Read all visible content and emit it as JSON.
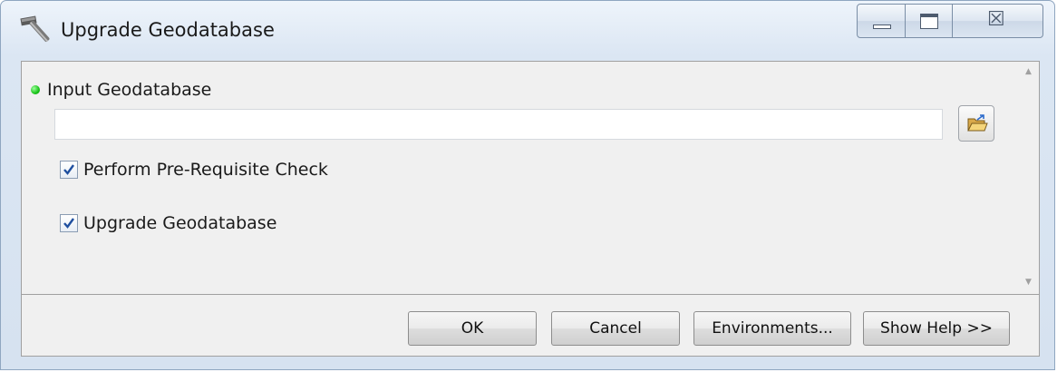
{
  "window": {
    "title": "Upgrade Geodatabase",
    "title_icon": "hammer-icon",
    "caption_buttons": {
      "minimize_icon": "minimize-icon",
      "maximize_icon": "maximize-icon",
      "close_icon": "close-icon",
      "close_glyph": "☒"
    }
  },
  "parameters": {
    "input_geodatabase": {
      "label": "Input Geodatabase",
      "required_indicator": "green-dot-icon",
      "value": "",
      "browse_icon": "open-folder-icon"
    },
    "checkboxes": [
      {
        "label": "Perform Pre-Requisite Check",
        "checked": true
      },
      {
        "label": "Upgrade Geodatabase",
        "checked": true
      }
    ]
  },
  "buttons": {
    "ok": "OK",
    "cancel": "Cancel",
    "environments": "Environments...",
    "show_help": "Show Help >>"
  },
  "scrollbar": {
    "up_icon": "scroll-up-arrow-icon",
    "down_icon": "scroll-down-arrow-icon",
    "up_glyph": "▲",
    "down_glyph": "▼"
  },
  "colors": {
    "required_dot": "#17c317",
    "check_mark": "#1f4f9f"
  }
}
